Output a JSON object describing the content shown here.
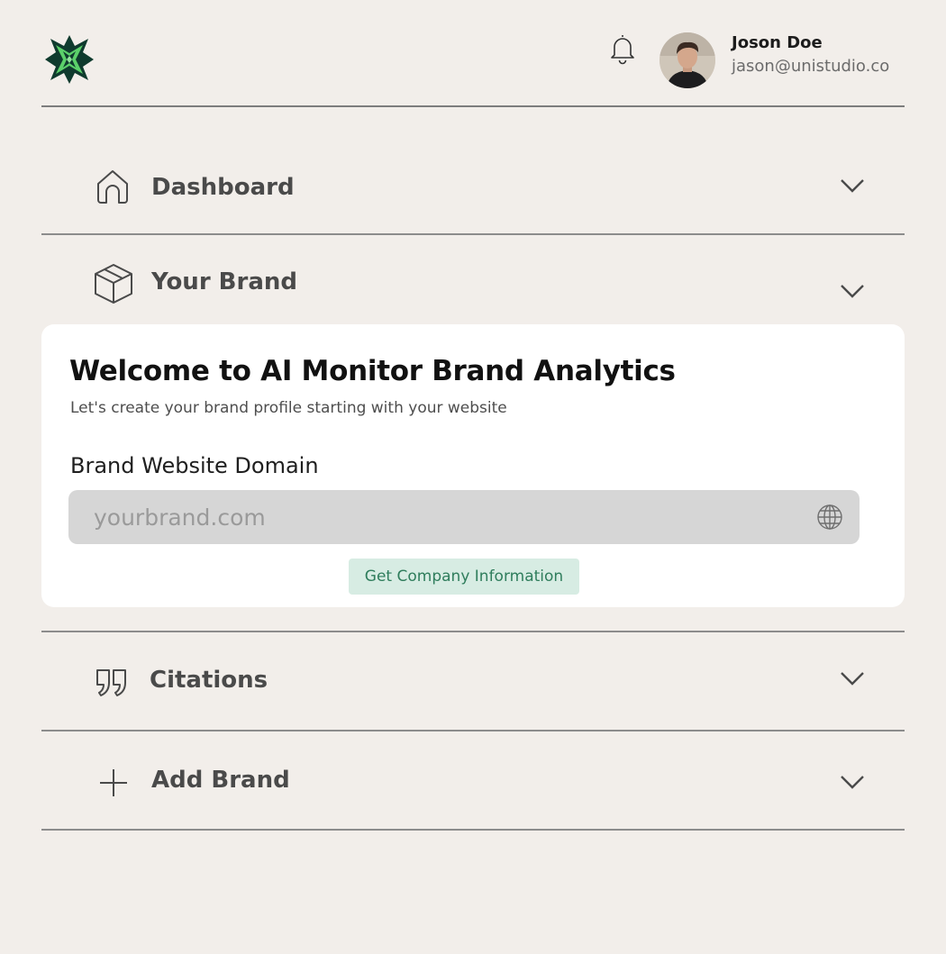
{
  "header": {
    "logo_icon": "star-x-logo",
    "notification_icon": "bell-icon",
    "user": {
      "name": "Joson Doe",
      "email": "jason@unistudio.co"
    }
  },
  "nav": {
    "items": [
      {
        "label": "Dashboard",
        "icon": "home-icon",
        "expanded": false
      },
      {
        "label": "Your Brand",
        "icon": "box-icon",
        "expanded": true
      },
      {
        "label": "Citations",
        "icon": "quote-icon",
        "expanded": false
      },
      {
        "label": "Add Brand",
        "icon": "plus-icon",
        "expanded": false
      }
    ]
  },
  "brand_card": {
    "title": "Welcome to AI Monitor Brand Analytics",
    "subtitle": "Let's create your brand profile starting with your website",
    "domain_label": "Brand Website Domain",
    "domain_placeholder": "yourbrand.com",
    "domain_value": "",
    "button_label": "Get Company Information"
  },
  "colors": {
    "background": "#f2eeea",
    "card": "#ffffff",
    "input_bg": "#d6d6d6",
    "button_bg": "#d7ece3",
    "button_text": "#2f7d5c",
    "logo_dark": "#0f3b2e",
    "logo_green": "#5bd16a"
  }
}
